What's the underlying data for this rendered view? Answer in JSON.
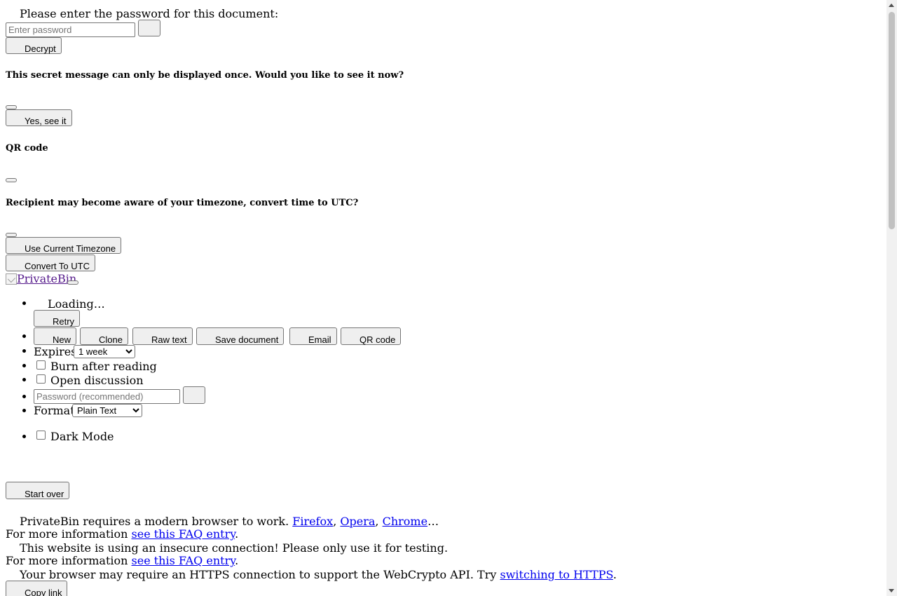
{
  "password_prompt": {
    "label": "Please enter the password for this document:",
    "placeholder": "Enter password",
    "decrypt_label": "Decrypt"
  },
  "burn_notice": {
    "heading": "This secret message can only be displayed once. Would you like to see it now?",
    "confirm_label": "Yes, see it"
  },
  "qr_modal": {
    "heading": "QR code"
  },
  "timezone_modal": {
    "heading": "Recipient may become aware of your timezone, convert time to UTC?",
    "current_label": "Use Current Timezone",
    "utc_label": "Convert To UTC"
  },
  "brand": {
    "alt": "PrivateBin"
  },
  "nav": {
    "loading": "Loading…",
    "retry": "Retry",
    "new": "New",
    "clone": "Clone",
    "raw": "Raw text",
    "save": "Save document",
    "email": "Email",
    "qrcode": "QR code",
    "expires_label": "Expires:",
    "expires_value": "1 week",
    "burn_label": "Burn after reading",
    "discussion_label": "Open discussion",
    "password_placeholder": "Password (recommended)",
    "format_label": "Format:",
    "format_value": "Plain Text",
    "dark_mode_label": "Dark Mode"
  },
  "start_over": "Start over",
  "messages": {
    "old_browser": {
      "text": "PrivateBin requires a modern browser to work.",
      "links": [
        "Firefox",
        "Opera",
        "Chrome"
      ],
      "sep": ",",
      "ellipsis": "…",
      "more_info": "For more information",
      "faq_link": "see this FAQ entry",
      "period": "."
    },
    "insecure": {
      "text": "This website is using an insecure connection! Please only use it for testing.",
      "more_info": "For more information",
      "faq_link": "see this FAQ entry",
      "period": "."
    },
    "https": {
      "text": "Your browser may require an HTTPS connection to support the WebCrypto API. Try",
      "link": "switching to HTTPS",
      "period": "."
    }
  },
  "copy_link": "Copy link"
}
